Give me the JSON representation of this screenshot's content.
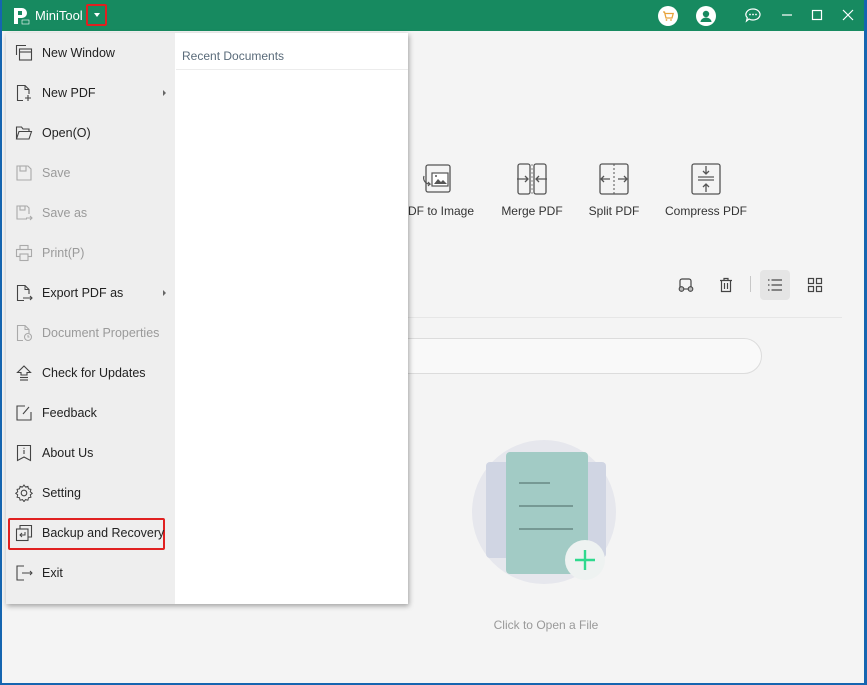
{
  "titlebar": {
    "app_name": "MiniTool",
    "icons": [
      "cart-icon",
      "user-icon",
      "feedback-chat-icon"
    ],
    "window_controls": [
      "minimize",
      "maximize",
      "close"
    ]
  },
  "menu": {
    "items": [
      {
        "label": "New Window",
        "icon": "new-window-icon",
        "enabled": true,
        "submenu": false
      },
      {
        "label": "New PDF",
        "icon": "new-pdf-icon",
        "enabled": true,
        "submenu": true
      },
      {
        "label": "Open(O)",
        "icon": "folder-open-icon",
        "enabled": true,
        "submenu": false
      },
      {
        "label": "Save",
        "icon": "save-icon",
        "enabled": false,
        "submenu": false
      },
      {
        "label": "Save as",
        "icon": "save-as-icon",
        "enabled": false,
        "submenu": false
      },
      {
        "label": "Print(P)",
        "icon": "printer-icon",
        "enabled": false,
        "submenu": false
      },
      {
        "label": "Export PDF as",
        "icon": "export-icon",
        "enabled": true,
        "submenu": true
      },
      {
        "label": "Document Properties",
        "icon": "document-properties-icon",
        "enabled": false,
        "submenu": false
      },
      {
        "label": "Check for Updates",
        "icon": "update-icon",
        "enabled": true,
        "submenu": false
      },
      {
        "label": "Feedback",
        "icon": "feedback-icon",
        "enabled": true,
        "submenu": false
      },
      {
        "label": "About Us",
        "icon": "info-bookmark-icon",
        "enabled": true,
        "submenu": false
      },
      {
        "label": "Setting",
        "icon": "gear-icon",
        "enabled": true,
        "submenu": false
      },
      {
        "label": "Backup and Recovery",
        "icon": "backup-icon",
        "enabled": true,
        "submenu": false,
        "highlighted": true
      },
      {
        "label": "Exit",
        "icon": "exit-icon",
        "enabled": true,
        "submenu": false
      }
    ],
    "recent_title": "Recent Documents"
  },
  "tools": [
    {
      "label": "PDF to Image",
      "icon": "pdf-to-image-icon"
    },
    {
      "label": "Merge PDF",
      "icon": "merge-pdf-icon"
    },
    {
      "label": "Split PDF",
      "icon": "split-pdf-icon"
    },
    {
      "label": "Compress PDF",
      "icon": "compress-pdf-icon"
    }
  ],
  "file_actions": {
    "view_mode": "list"
  },
  "open_file": {
    "label": "Click to Open a File"
  },
  "colors": {
    "titlebar": "#178a60",
    "highlight": "#e02020",
    "window_border": "#1565b0"
  }
}
